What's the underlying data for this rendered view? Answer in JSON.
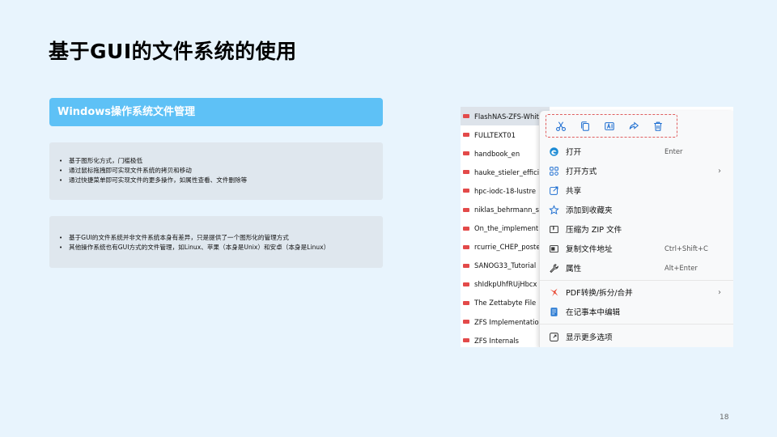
{
  "slide": {
    "title": "基于GUI的文件系统的使用",
    "section_header": "Windows操作系统文件管理",
    "box1": [
      "基于图形化方式，门槛极低",
      "通过鼠标拖拽即可实现文件系统的拷贝和移动",
      "通过快捷菜单即可实现文件的更多操作，如属性查看、文件删除等"
    ],
    "box2": [
      "基于GUI的文件系统并非文件系统本身有差异，只是提供了一个图形化的管理方式",
      "其他操作系统也有GUI方式的文件管理，如Linux、苹果（本身是Unix）和安卓（本身是Linux）"
    ],
    "page_number": "18"
  },
  "explorer": {
    "files": [
      "FlashNAS-ZFS-Whit",
      "FULLTEXT01",
      "handbook_en",
      "hauke_stieler_effici",
      "hpc-iodc-18-lustre",
      "niklas_behrmann_s",
      "On_the_implement",
      "rcurrie_CHEP_poste",
      "SANOG33_Tutorial",
      "shIdkpUhfRUjHbcx",
      "The Zettabyte File",
      "ZFS Implementation",
      "ZFS Internals"
    ],
    "selected_index": 0,
    "file_icon_color": "#e34a4a"
  },
  "context_menu": {
    "quick_actions": [
      "cut-icon",
      "copy-icon",
      "rename-icon",
      "share-icon",
      "delete-icon"
    ],
    "items": [
      {
        "label": "打开",
        "shortcut": "Enter",
        "arrow": "",
        "icon": "edge-icon"
      },
      {
        "label": "打开方式",
        "shortcut": "",
        "arrow": "›",
        "icon": "open-with-icon"
      },
      {
        "label": "共享",
        "shortcut": "",
        "arrow": "",
        "icon": "share-icon"
      },
      {
        "label": "添加到收藏夹",
        "shortcut": "",
        "arrow": "",
        "icon": "star-icon"
      },
      {
        "label": "压缩为 ZIP 文件",
        "shortcut": "",
        "arrow": "",
        "icon": "zip-icon"
      },
      {
        "label": "复制文件地址",
        "shortcut": "Ctrl+Shift+C",
        "arrow": "",
        "icon": "copy-path-icon"
      },
      {
        "label": "属性",
        "shortcut": "Alt+Enter",
        "arrow": "",
        "icon": "wrench-icon"
      },
      {
        "label": "PDF转换/拆分/合并",
        "shortcut": "",
        "arrow": "›",
        "icon": "pdf-tool-icon"
      },
      {
        "label": "在记事本中编辑",
        "shortcut": "",
        "arrow": "",
        "icon": "notepad-icon"
      },
      {
        "label": "显示更多选项",
        "shortcut": "",
        "arrow": "",
        "icon": "more-options-icon"
      }
    ]
  },
  "colors": {
    "background": "#e8f4fd",
    "header_accent": "#5ec1f6",
    "box_fill": "#dfe7ee",
    "quick_bar_border": "#e06060",
    "icon_blue": "#1f6fd1"
  }
}
